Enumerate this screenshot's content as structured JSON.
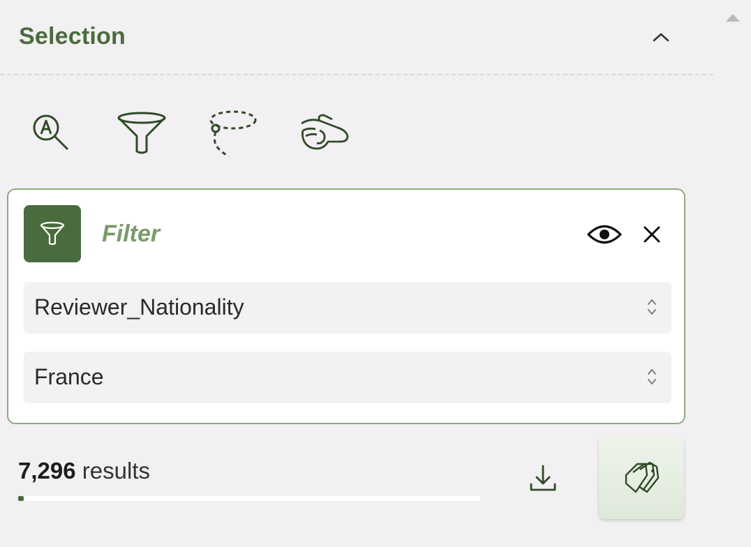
{
  "panel": {
    "title": "Selection",
    "collapse_icon": "chevron-up-icon"
  },
  "tools": [
    {
      "name": "text-search-icon"
    },
    {
      "name": "filter-funnel-icon"
    },
    {
      "name": "lasso-icon"
    },
    {
      "name": "hand-pick-icon"
    }
  ],
  "filter": {
    "title": "Filter",
    "field": {
      "value": "Reviewer_Nationality"
    },
    "value": {
      "value": "France"
    }
  },
  "results": {
    "count": "7,296",
    "label": "results",
    "progress": 0.012
  },
  "colors": {
    "accent": "#4a6b3e",
    "accent_light": "#7a9b6c",
    "background": "#f2f0f2"
  }
}
